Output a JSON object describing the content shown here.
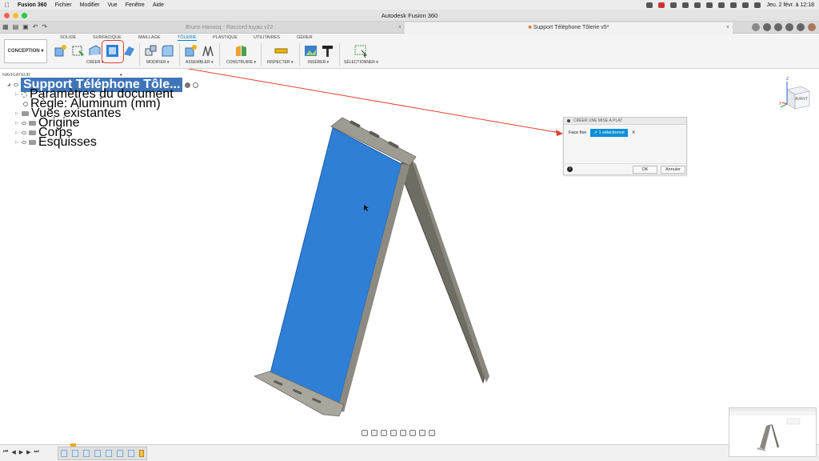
{
  "menubar": {
    "app": "Fusion 360",
    "items": [
      "Fichier",
      "Modifier",
      "Vue",
      "Fenêtre",
      "Aide"
    ],
    "clock": "Jeu. 2 févr. à 12:18"
  },
  "window": {
    "title": "Autodesk Fusion 360"
  },
  "tabs": [
    {
      "label": "Bruno Hanocq - Raccord tuyau v22",
      "active": false
    },
    {
      "label": "Support Téléphone Tôlerie v5*",
      "active": true
    }
  ],
  "toolbar": {
    "workspace": "CONCEPTION",
    "workspace_tabs": [
      "SOLIDE",
      "SURFACIQUE",
      "MAILLAGE",
      "TÔLERIE",
      "PLASTIQUE",
      "UTILITAIRES",
      "GÉRER"
    ],
    "groups": [
      "CRÉER",
      "MODIFIER",
      "ASSEMBLER",
      "CONSTRUIRE",
      "INSPECTER",
      "INSÉRER",
      "SÉLECTIONNER"
    ]
  },
  "browser": {
    "header": "NAVIGATEUR",
    "root": "Support Téléphone Tôle...",
    "items": [
      "Paramètres du document",
      "Règle: Aluminum (mm)",
      "Vues existantes",
      "Origine",
      "Corps",
      "Esquisses"
    ]
  },
  "dialog": {
    "title": "CRÉER UNE MISE À PLAT",
    "field_label": "Face fixe",
    "selection": "1 sélectionné",
    "ok": "OK",
    "cancel": "Annuler"
  },
  "viewcube": {
    "face": "AVANT",
    "axis_z": "Z",
    "axis_x": "X"
  },
  "colors": {
    "selected_face": "#2f7fd6",
    "body": "#7a786f",
    "accent": "#0b8fd6",
    "annotation": "#e4402a"
  }
}
